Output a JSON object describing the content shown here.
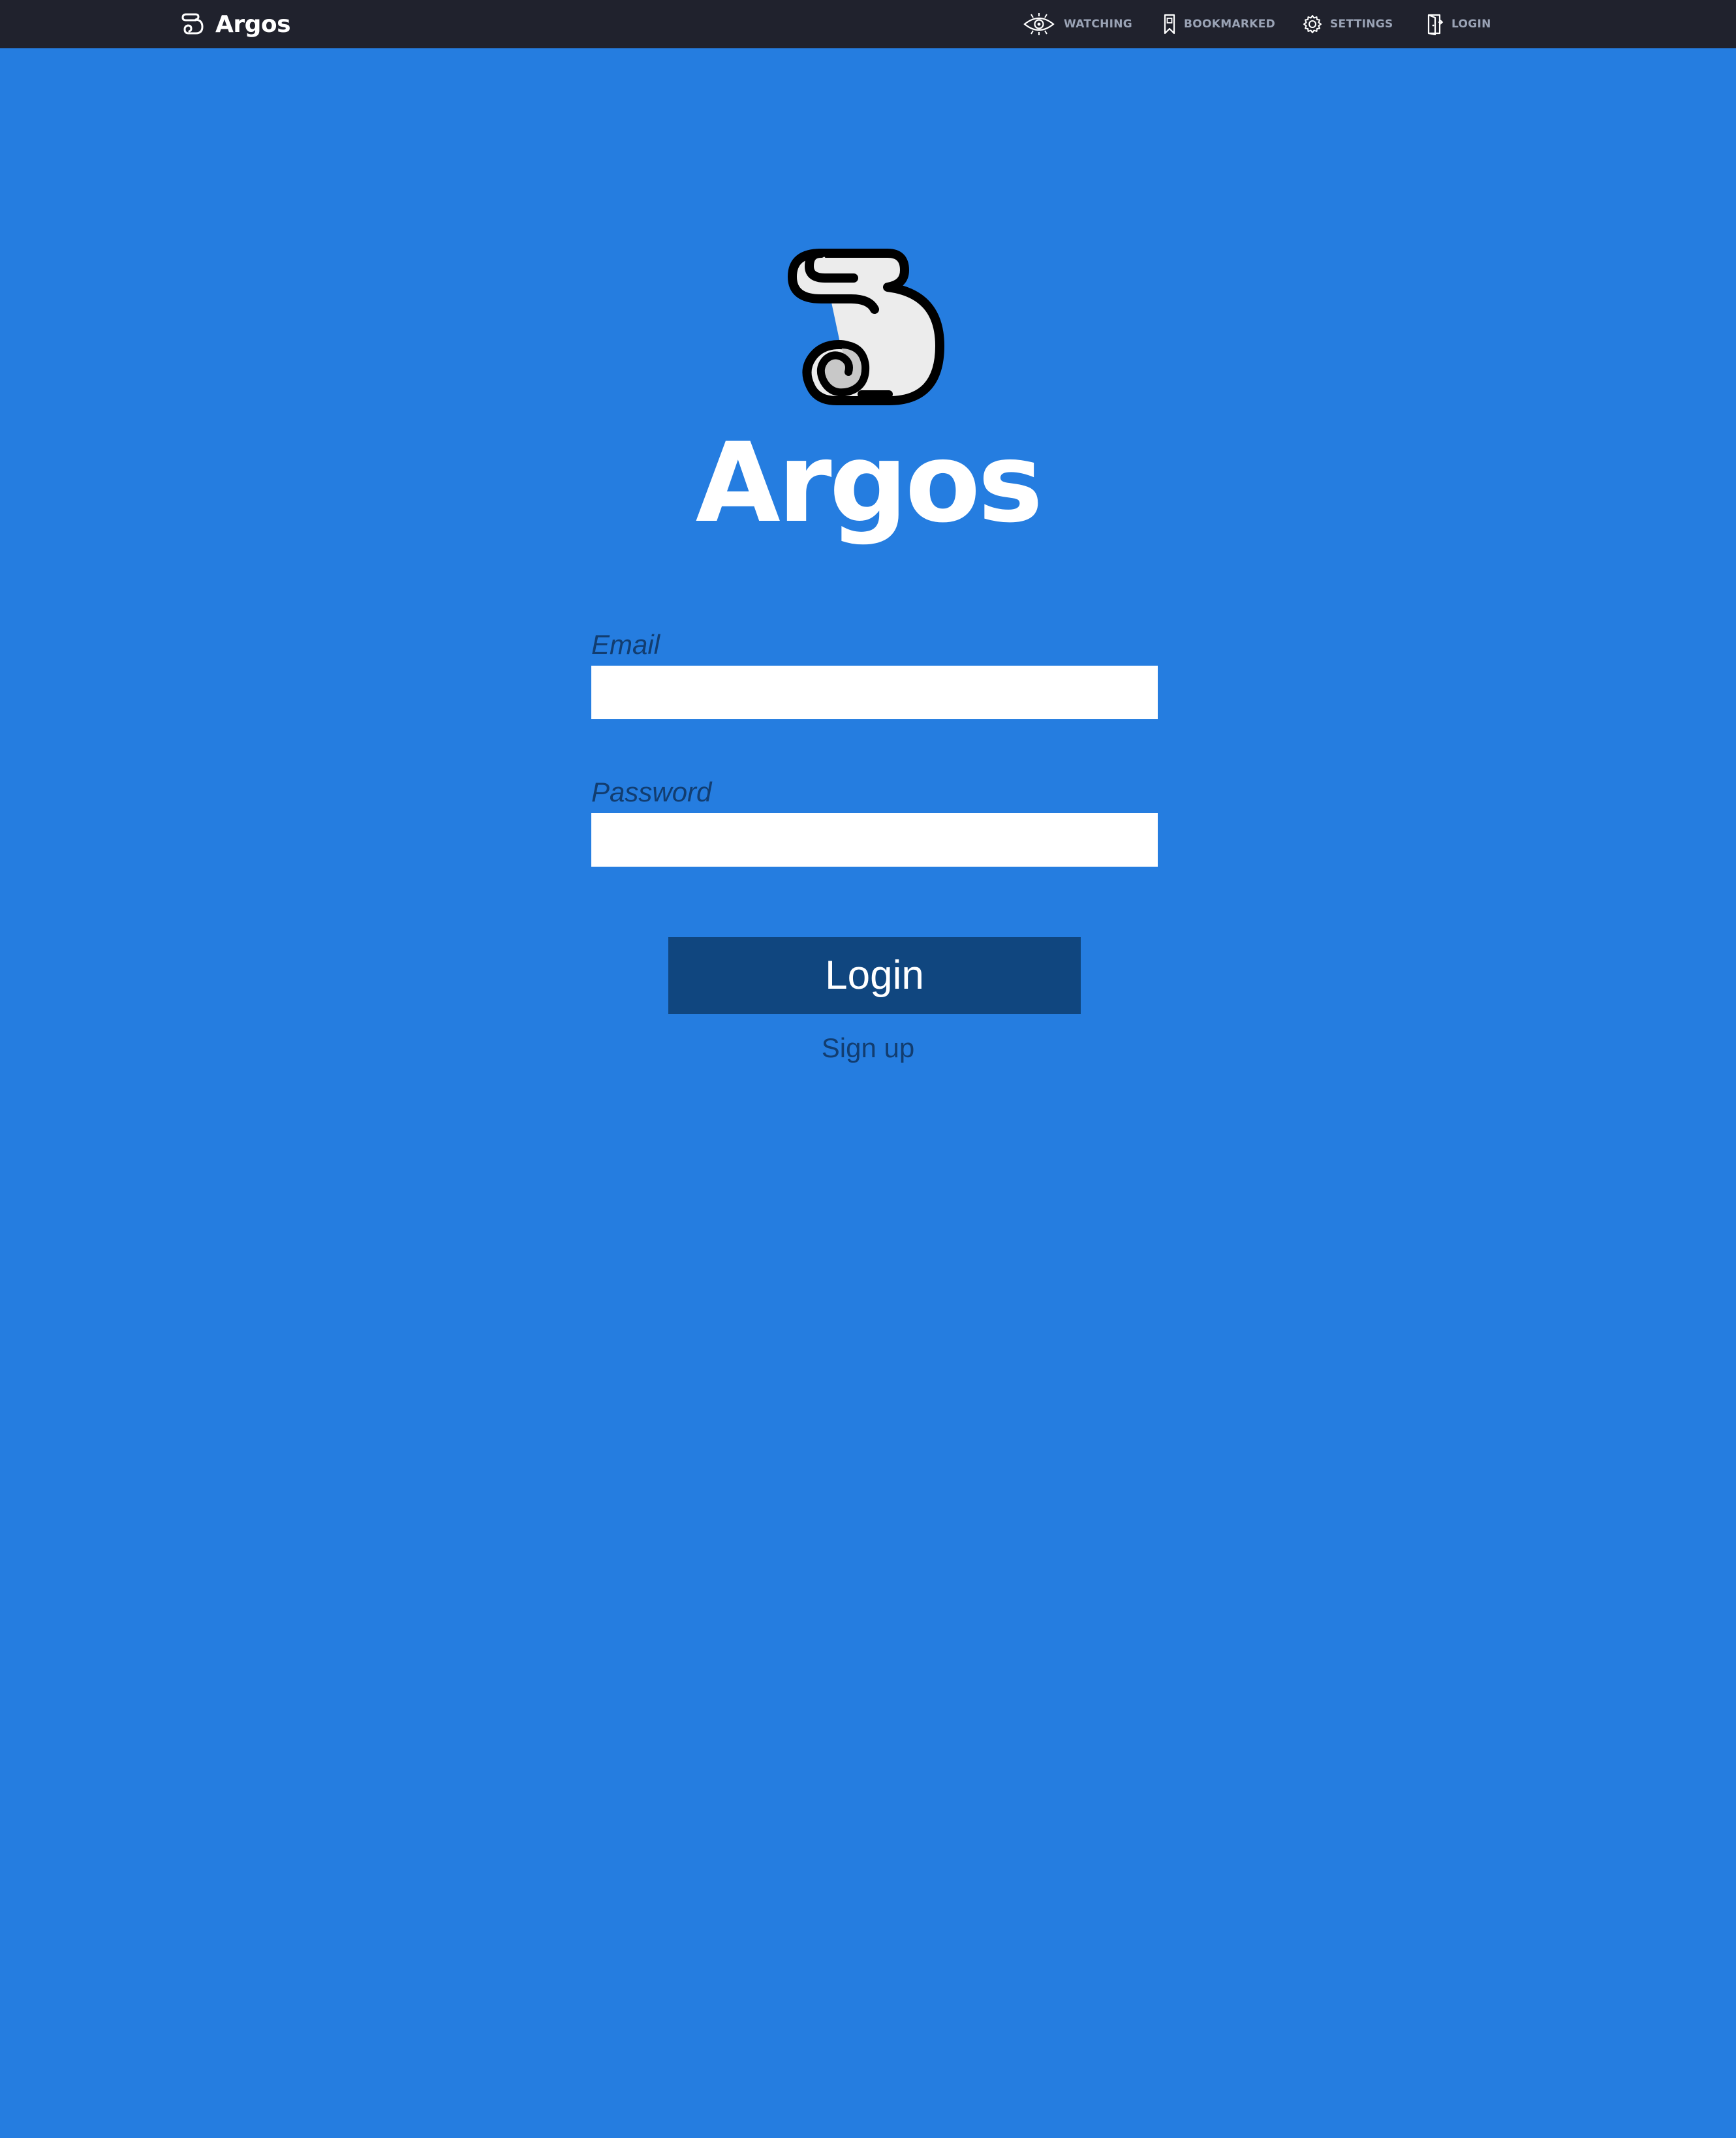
{
  "navbar": {
    "brand": {
      "name": "Argos",
      "icon": "scroll-icon"
    },
    "items": [
      {
        "id": "watching",
        "label": "WATCHING",
        "icon": "eye-icon"
      },
      {
        "id": "bookmarked",
        "label": "BOOKMARKED",
        "icon": "bookmark-icon"
      },
      {
        "id": "settings",
        "label": "SETTINGS",
        "icon": "gear-icon"
      },
      {
        "id": "login",
        "label": "LOGIN",
        "icon": "door-icon"
      }
    ]
  },
  "hero": {
    "logo_icon": "scroll-logo-icon",
    "title": "Argos"
  },
  "form": {
    "email": {
      "label": "Email",
      "value": "",
      "placeholder": ""
    },
    "password": {
      "label": "Password",
      "value": "",
      "placeholder": ""
    },
    "submit_label": "Login",
    "signup_label": "Sign up"
  },
  "colors": {
    "background": "#257de0",
    "navbar": "#20222d",
    "nav_text": "#9aa3b5",
    "button": "#10467f",
    "label_text": "#123d70"
  }
}
